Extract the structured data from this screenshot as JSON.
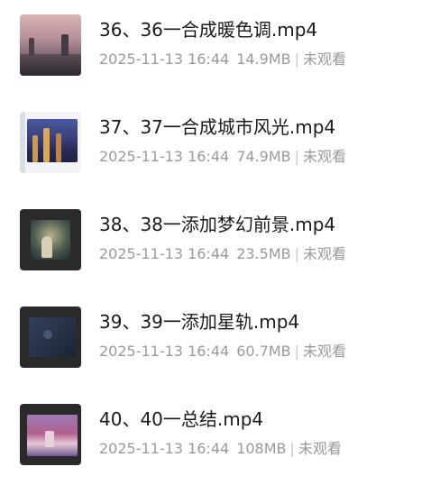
{
  "files": [
    {
      "title": "36、36一合成暖色调.mp4",
      "date": "2025-11-13 16:44",
      "size": "14.9MB",
      "status": "未观看",
      "thumb_colors": [
        "#c9a6a8",
        "#7c6d7a",
        "#3a2f3a"
      ]
    },
    {
      "title": "37、37一合成城市风光.mp4",
      "date": "2025-11-13 16:44",
      "size": "74.9MB",
      "status": "未观看",
      "thumb_colors": [
        "#e9eef5",
        "#3b4a86",
        "#d99a45"
      ]
    },
    {
      "title": "38、38一添加梦幻前景.mp4",
      "date": "2025-11-13 16:44",
      "size": "23.5MB",
      "status": "未观看",
      "thumb_colors": [
        "#2b2b2b",
        "#36424f",
        "#c9b785"
      ]
    },
    {
      "title": "39、39一添加星轨.mp4",
      "date": "2025-11-13 16:44",
      "size": "60.7MB",
      "status": "未观看",
      "thumb_colors": [
        "#2b2b2b",
        "#263247",
        "#5a6f8f"
      ]
    },
    {
      "title": "40、40一总结.mp4",
      "date": "2025-11-13 16:44",
      "size": "108MB",
      "status": "未观看",
      "thumb_colors": [
        "#2b2b2b",
        "#b0628e",
        "#e7c7d8"
      ]
    }
  ],
  "separator": "|"
}
